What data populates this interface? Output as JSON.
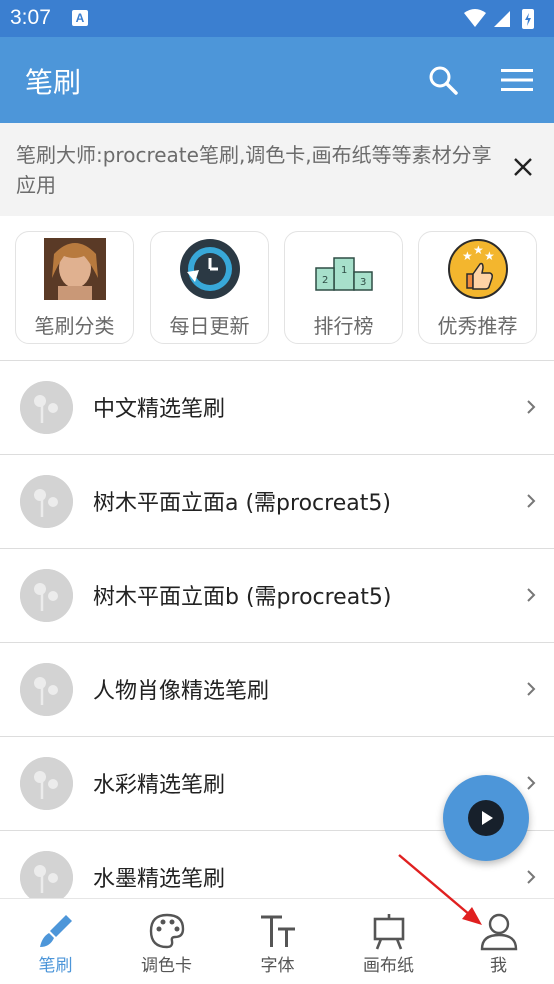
{
  "status_bar": {
    "time": "3:07",
    "notification_letter": "A"
  },
  "app_bar": {
    "title": "笔刷"
  },
  "banner": {
    "text": "笔刷大师:procreate笔刷,调色卡,画布纸等等素材分享应用"
  },
  "quick_links": [
    {
      "label": "笔刷分类",
      "icon": "portrait-photo-icon"
    },
    {
      "label": "每日更新",
      "icon": "clock-refresh-icon"
    },
    {
      "label": "排行榜",
      "icon": "podium-icon"
    },
    {
      "label": "优秀推荐",
      "icon": "thumbs-up-stars-icon"
    }
  ],
  "list": {
    "items": [
      {
        "label": "中文精选笔刷"
      },
      {
        "label": "树木平面立面a (需procreat5)"
      },
      {
        "label": "树木平面立面b (需procreat5)"
      },
      {
        "label": "人物肖像精选笔刷"
      },
      {
        "label": "水彩精选笔刷"
      },
      {
        "label": "水墨精选笔刷"
      }
    ]
  },
  "bottom_nav": {
    "active": 0,
    "items": [
      {
        "label": "笔刷",
        "icon": "brush-icon"
      },
      {
        "label": "调色卡",
        "icon": "palette-icon"
      },
      {
        "label": "字体",
        "icon": "font-icon"
      },
      {
        "label": "画布纸",
        "icon": "easel-icon"
      },
      {
        "label": "我",
        "icon": "person-icon"
      }
    ]
  },
  "colors": {
    "status_bar": "#3b7fd0",
    "app_bar": "#4d96d9",
    "accent": "#4d96d9",
    "banner_bg": "#f3f3f3",
    "annotation_arrow": "#e02020"
  }
}
